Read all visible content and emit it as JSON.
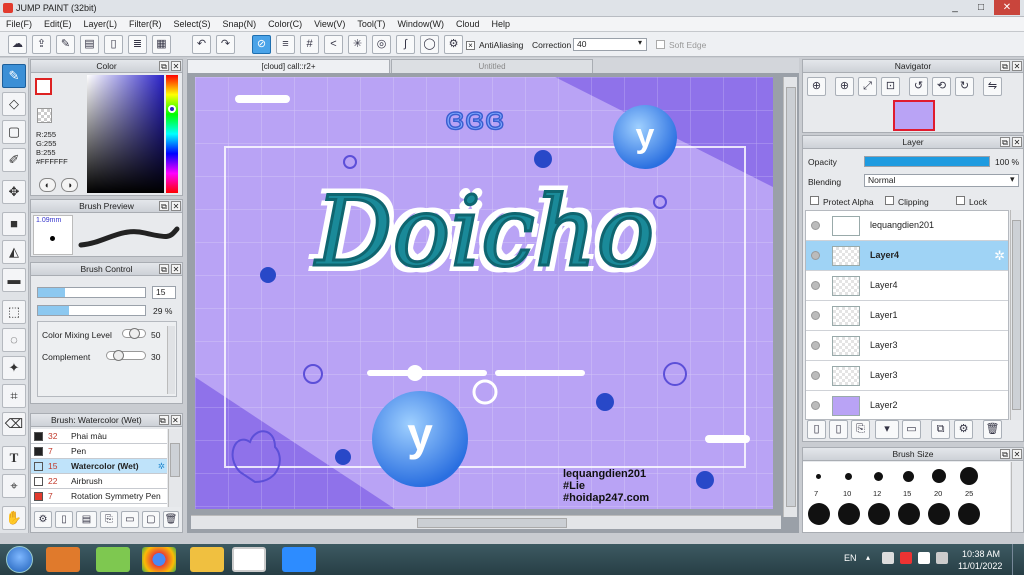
{
  "title": "JUMP PAINT (32bit)",
  "window_controls": [
    "_",
    "□",
    "✕"
  ],
  "menu": [
    "File(F)",
    "Edit(E)",
    "Layer(L)",
    "Filter(R)",
    "Select(S)",
    "Snap(N)",
    "Color(C)",
    "View(V)",
    "Tool(T)",
    "Window(W)",
    "Cloud",
    "Help"
  ],
  "toolbar": {
    "antialias_label": "AntiAliasing",
    "correction_label": "Correction",
    "correction_value": "40",
    "softedge_label": "Soft Edge"
  },
  "tabs": [
    "[cloud] call::r2+",
    "Untitled"
  ],
  "color_panel": {
    "title": "Color",
    "r": "R:255",
    "g": "G:255",
    "b": "B:255",
    "hex": "#FFFFFF"
  },
  "brush_preview": {
    "title": "Brush Preview",
    "size": "1.09mm"
  },
  "brush_control": {
    "title": "Brush Control",
    "size_value": "15",
    "opacity_value": "29 %",
    "size_fraction": 0.25,
    "opacity_fraction": 0.29,
    "mix_label": "Color Mixing Level",
    "mix_value": "50",
    "complement_label": "Complement",
    "complement_value": "30"
  },
  "brush_list": {
    "title": "Brush: Watercolor (Wet)",
    "items": [
      {
        "num": "32",
        "name": "Phai màu",
        "color": "#222222"
      },
      {
        "num": "7",
        "name": "Pen",
        "color": "#222222"
      },
      {
        "num": "15",
        "name": "Watercolor (Wet)",
        "color": "#bfe3fa"
      },
      {
        "num": "22",
        "name": "Airbrush",
        "color": "#ffffff"
      },
      {
        "num": "7",
        "name": "Rotation Symmetry Pen",
        "color": "#e23b2e"
      }
    ]
  },
  "navigator": {
    "title": "Navigator"
  },
  "layer_panel": {
    "title": "Layer",
    "opacity_label": "Opacity",
    "opacity_value": "100 %",
    "blending_label": "Blending",
    "blending_value": "Normal",
    "protect_alpha": "Protect Alpha",
    "clipping": "Clipping",
    "lock": "Lock",
    "layers": [
      "lequangdien201",
      "Layer4",
      "Layer4",
      "Layer1",
      "Layer3",
      "Layer3",
      "Layer2"
    ]
  },
  "brush_size": {
    "title": "Brush Size",
    "sizes": [
      "7",
      "10",
      "12",
      "15",
      "20",
      "25"
    ]
  },
  "artwork": {
    "main_word": "Doicho",
    "credit1": "lequangdien201",
    "credit2": "#Lie",
    "credit3": "#hoidap247.com",
    "letter": "y"
  },
  "taskbar": {
    "lang": "EN",
    "time": "10:38 AM",
    "date": "11/01/2022"
  },
  "colors": {
    "accent": "#3b8fd6",
    "canvas_bg": "#b9a3f5",
    "text_teal": "#1a8a99"
  }
}
